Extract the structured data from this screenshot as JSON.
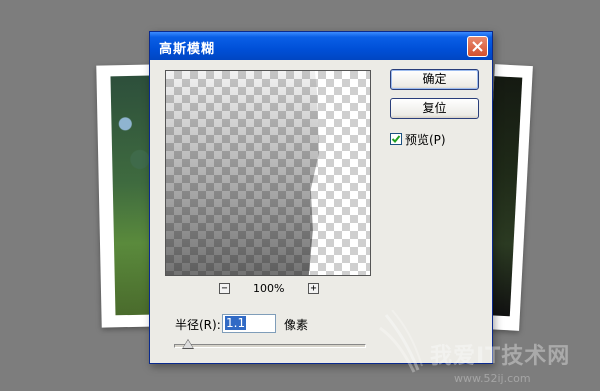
{
  "dialog": {
    "title": "高斯模糊",
    "buttons": {
      "ok": "确定",
      "reset": "复位"
    },
    "preview_checkbox": {
      "label": "预览(P)",
      "checked": true
    },
    "zoom": {
      "minus": "−",
      "plus": "+",
      "percent": "100%"
    },
    "radius": {
      "label": "半径(R):",
      "value": "1.1",
      "unit": "像素",
      "slider_fraction": 0.03
    }
  },
  "watermark": {
    "text": "我爱IT技术网",
    "sub": "www.52ij.com"
  },
  "colors": {
    "titlebar": "#0050d8",
    "close": "#d5502d",
    "background": "#7d7d7d"
  },
  "icons": {
    "close": "close-icon",
    "checkmark": "check-icon"
  }
}
